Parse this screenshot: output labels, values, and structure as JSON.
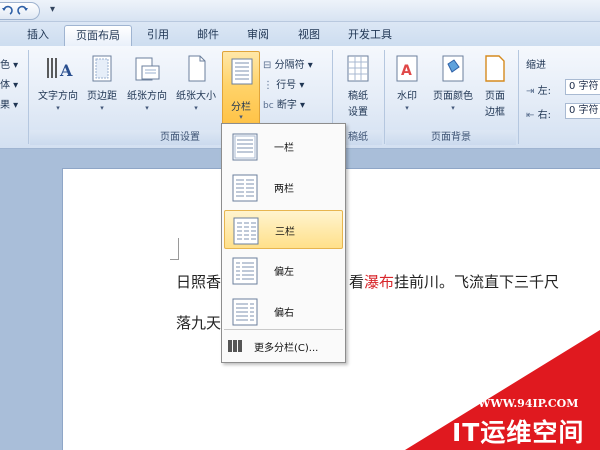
{
  "tabs": [
    {
      "label": "插入",
      "active": false
    },
    {
      "label": "页面布局",
      "active": true
    },
    {
      "label": "引用",
      "active": false
    },
    {
      "label": "邮件",
      "active": false
    },
    {
      "label": "审阅",
      "active": false
    },
    {
      "label": "视图",
      "active": false
    },
    {
      "label": "开发工具",
      "active": false
    }
  ],
  "ribbon": {
    "theme_partial": [
      "色",
      "体",
      "果"
    ],
    "page_setup": {
      "text_direction": "文字方向",
      "margins": "页边距",
      "orientation": "纸张方向",
      "size": "纸张大小",
      "columns": "分栏",
      "breaks": "分隔符",
      "line_numbers": "行号",
      "hyphenation": "断字",
      "group_label": "页面设置"
    },
    "manuscript": {
      "button_line1": "稿纸",
      "button_line2": "设置",
      "group_label": "稿纸"
    },
    "page_background": {
      "watermark": "水印",
      "page_color": "页面颜色",
      "page_border_line1": "页面",
      "page_border_line2": "边框",
      "group_label": "页面背景"
    },
    "indent": {
      "title": "缩进",
      "left_label": "左:",
      "left_value": "0 字符",
      "right_label": "右:",
      "right_value": "0 字符"
    }
  },
  "columns_menu": {
    "items": [
      {
        "label": "一栏"
      },
      {
        "label": "两栏"
      },
      {
        "label": "三栏"
      },
      {
        "label": "偏左"
      },
      {
        "label": "偏右"
      }
    ],
    "more": "更多分栏(C)..."
  },
  "document": {
    "line1_part1": "日照香",
    "line1_part2": "看",
    "line1_red": "瀑布",
    "line1_part3": "挂前川。飞流直下三千尺",
    "line2": "落九天"
  },
  "watermark": {
    "url": "WWW.94IP.COM",
    "title": "IT运维空间"
  },
  "colors": {
    "accent_orange": "#ffc245",
    "red_text": "#d8262b",
    "watermark_red": "#e0191f"
  }
}
